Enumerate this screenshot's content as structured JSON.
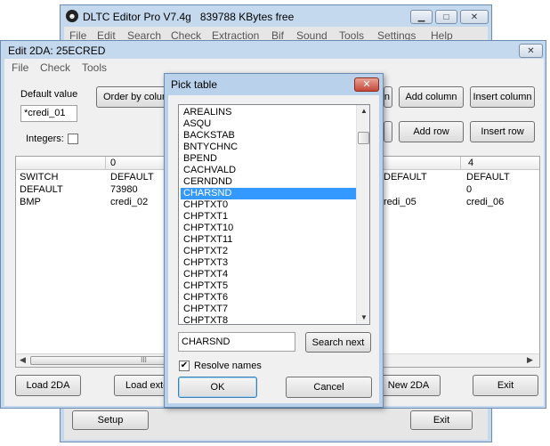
{
  "main_window": {
    "title": "DLTC Editor Pro V7.4g",
    "memory": "839788 KBytes free",
    "menu": [
      "File",
      "Edit",
      "Search",
      "Check",
      "Extraction",
      "Bif",
      "Sound",
      "Tools",
      "Settings",
      "Help"
    ],
    "setup_label": "Setup",
    "exit_label": "Exit"
  },
  "editor_window": {
    "title": "Edit 2DA: 25ECRED",
    "menu": [
      "File",
      "Check",
      "Tools"
    ],
    "default_value_label": "Default value",
    "default_value": "*credi_01",
    "order_by_column_label": "Order by colum",
    "column_btn_partial": "n",
    "add_column_label": "Add column",
    "insert_column_label": "Insert column",
    "integers_label": "Integers:",
    "add_row_label": "Add row",
    "insert_row_label": "Insert row",
    "table": {
      "header_col0": "0",
      "header_col4": "4",
      "rows": [
        {
          "label": "SWITCH",
          "c0": "DEFAULT",
          "c3": "DEFAULT",
          "c4": "DEFAULT"
        },
        {
          "label": "DEFAULT",
          "c0": "73980",
          "c3": "",
          "c4": "0"
        },
        {
          "label": "BMP",
          "c0": "credi_02",
          "c3": "redi_05",
          "c4": "credi_06"
        }
      ]
    },
    "scroll_thumb_glyph": "III",
    "load_2da_label": "Load 2DA",
    "load_ext_label": "Load exte",
    "new_2da_label": "New 2DA",
    "exit_label": "Exit"
  },
  "dialog": {
    "title": "Pick table",
    "items": [
      "AREALINS",
      "ASQU",
      "BACKSTAB",
      "BNTYCHNC",
      "BPEND",
      "CACHVALD",
      "CERNDND",
      "CHARSND",
      "CHPTXT0",
      "CHPTXT1",
      "CHPTXT10",
      "CHPTXT11",
      "CHPTXT2",
      "CHPTXT3",
      "CHPTXT4",
      "CHPTXT5",
      "CHPTXT6",
      "CHPTXT7",
      "CHPTXT8"
    ],
    "selected_index": 7,
    "search_value": "CHARSND",
    "search_next_label": "Search next",
    "resolve_names_label": "Resolve names",
    "resolve_names_checked": true,
    "ok_label": "OK",
    "cancel_label": "Cancel"
  }
}
